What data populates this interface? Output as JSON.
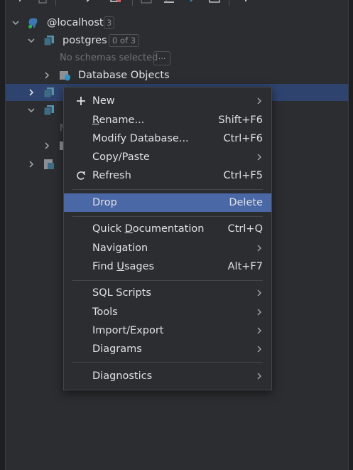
{
  "colors": {
    "panel_bg": "#2b2d30",
    "selection": "#2e436e",
    "menu_highlight": "#4a67a6",
    "text": "#dfe1e5",
    "muted": "#6f737a"
  },
  "tree": {
    "root": {
      "label": "@localhost",
      "count": "3",
      "icon": "postgres-elephant-icon"
    },
    "db": {
      "label": "postgres",
      "badge": "0 of 3",
      "icon": "database-icon"
    },
    "schemas_hint": "No schemas selected",
    "schemas_button": "...",
    "objects": {
      "label": "Database Objects",
      "icon": "database-objects-icon"
    },
    "partial_letter": "N"
  },
  "menu": {
    "items": [
      {
        "name": "new",
        "label": "New",
        "shortcut": "",
        "submenu": true,
        "icon": "plus-icon"
      },
      {
        "name": "rename",
        "label_pre": "",
        "label_ul": "R",
        "label_post": "ename...",
        "shortcut": "Shift+F6"
      },
      {
        "name": "modify-database",
        "label": "Modify Database...",
        "shortcut": "Ctrl+F6"
      },
      {
        "name": "copy-paste",
        "label": "Copy/Paste",
        "submenu": true
      },
      {
        "name": "refresh",
        "label": "Refresh",
        "shortcut": "Ctrl+F5",
        "icon": "refresh-icon"
      },
      {
        "name": "drop",
        "label": "Drop",
        "shortcut": "Delete",
        "highlighted": true
      },
      {
        "name": "quick-documentation",
        "label_pre": "Quick ",
        "label_ul": "D",
        "label_post": "ocumentation",
        "shortcut": "Ctrl+Q"
      },
      {
        "name": "navigation",
        "label": "Navigation",
        "submenu": true
      },
      {
        "name": "find-usages",
        "label_pre": "Find ",
        "label_ul": "U",
        "label_post": "sages",
        "shortcut": "Alt+F7"
      },
      {
        "name": "sql-scripts",
        "label": "SQL Scripts",
        "submenu": true
      },
      {
        "name": "tools",
        "label": "Tools",
        "submenu": true
      },
      {
        "name": "import-export",
        "label": "Import/Export",
        "submenu": true
      },
      {
        "name": "diagrams",
        "label": "Diagrams",
        "submenu": true
      },
      {
        "name": "diagnostics",
        "label": "Diagnostics",
        "submenu": true
      }
    ]
  }
}
